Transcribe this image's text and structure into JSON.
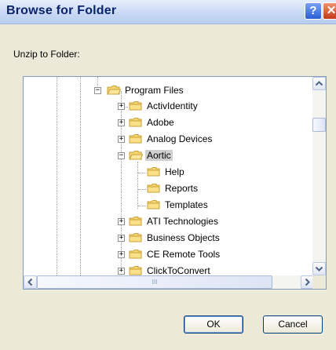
{
  "window": {
    "title": "Browse for Folder",
    "help_glyph": "?",
    "close_glyph": "✕"
  },
  "prompt": "Unzip to Folder:",
  "tree": {
    "root": {
      "label": "Program Files",
      "expander": "−"
    },
    "items": [
      {
        "label": "ActivIdentity",
        "expander": "+"
      },
      {
        "label": "Adobe",
        "expander": "+"
      },
      {
        "label": "Analog Devices",
        "expander": "+"
      },
      {
        "label": "Aortic",
        "expander": "−",
        "selected": true
      },
      {
        "label": "Help",
        "child": true
      },
      {
        "label": "Reports",
        "child": true
      },
      {
        "label": "Templates",
        "child": true
      },
      {
        "label": "ATI Technologies",
        "expander": "+"
      },
      {
        "label": "Business Objects",
        "expander": "+"
      },
      {
        "label": "CE Remote Tools",
        "expander": "+"
      },
      {
        "label": "ClickToConvert",
        "expander": "+"
      }
    ],
    "hscroll_grip": "III"
  },
  "buttons": {
    "ok": "OK",
    "cancel": "Cancel"
  },
  "colors": {
    "folder": "#f5d774",
    "folder_edge": "#c9a136",
    "titlebar_text": "#0a246a"
  }
}
